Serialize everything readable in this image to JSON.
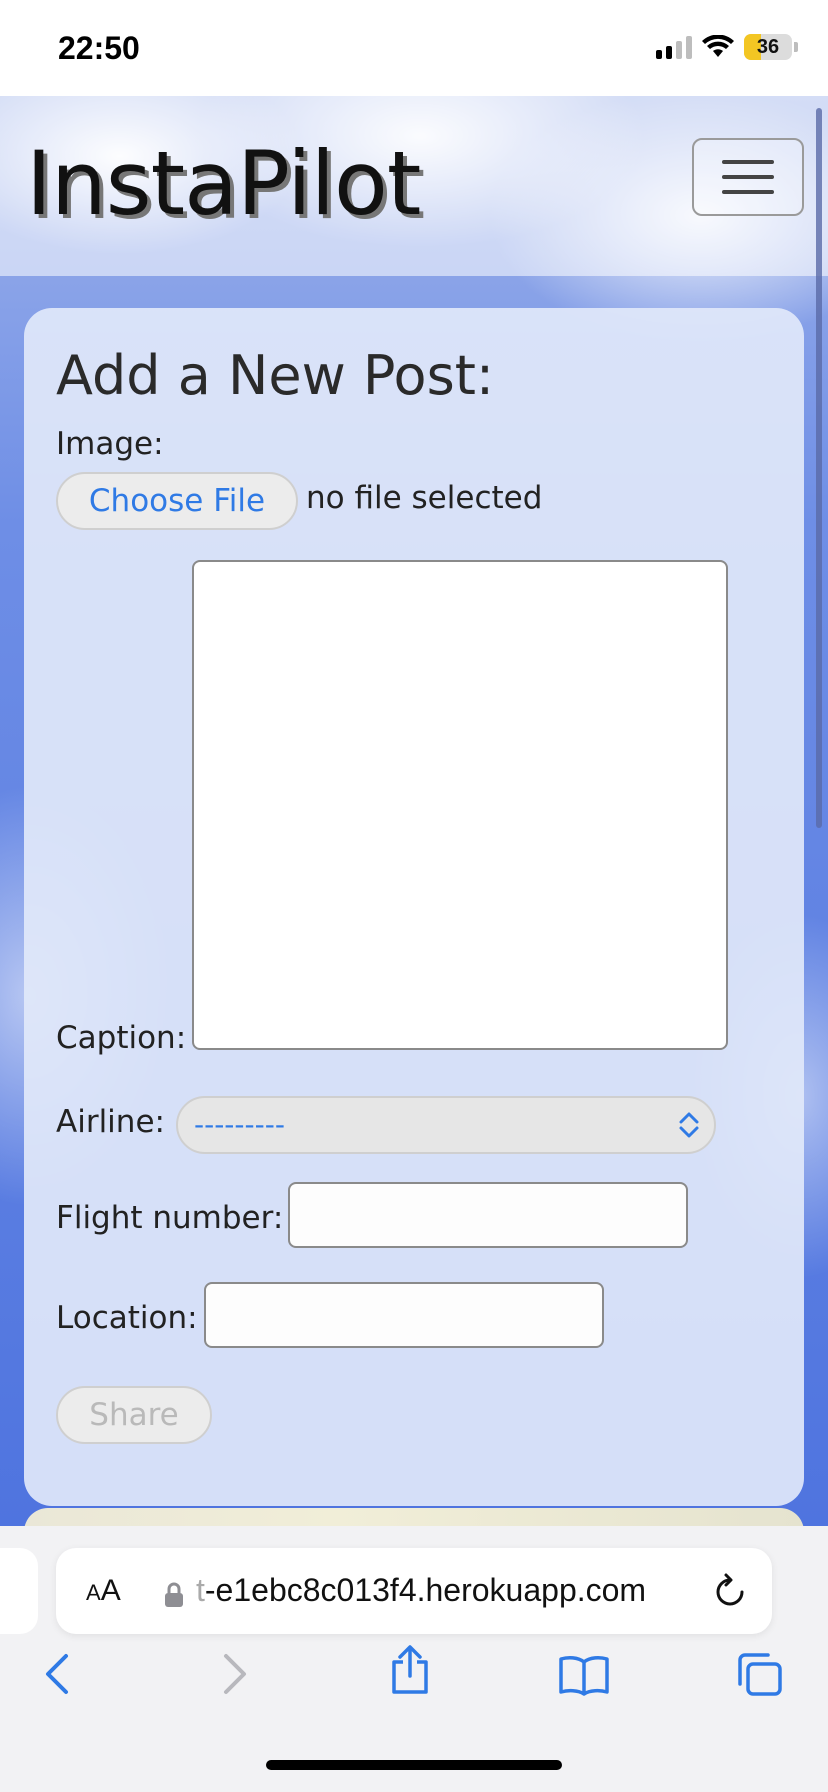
{
  "status_bar": {
    "time": "22:50",
    "battery": "36",
    "battery_level": 0.36,
    "battery_color": "#f3c623",
    "icons": [
      "signal-icon",
      "wifi-icon",
      "battery-icon"
    ]
  },
  "navbar": {
    "brand": "InstaPilot",
    "menu_icon": "hamburger-icon"
  },
  "form": {
    "title": "Add a New Post:",
    "image_label": "Image:",
    "choose_file_label": "Choose File",
    "file_status": "no file selected",
    "caption_label": "Caption:",
    "caption_value": "",
    "airline_label": "Airline:",
    "airline_selected": "---------",
    "flight_number_label": "Flight number:",
    "flight_number_value": "",
    "location_label": "Location:",
    "location_value": "",
    "share_label": "Share"
  },
  "browser": {
    "text_size_small": "A",
    "text_size_large": "A",
    "url_faded": "t",
    "url": "-e1ebc8c013f4.herokuapp.com",
    "accent": "#2f7ae5",
    "toolbar_icons": [
      "back-icon",
      "forward-icon",
      "share-icon",
      "bookmarks-icon",
      "tabs-icon"
    ]
  }
}
